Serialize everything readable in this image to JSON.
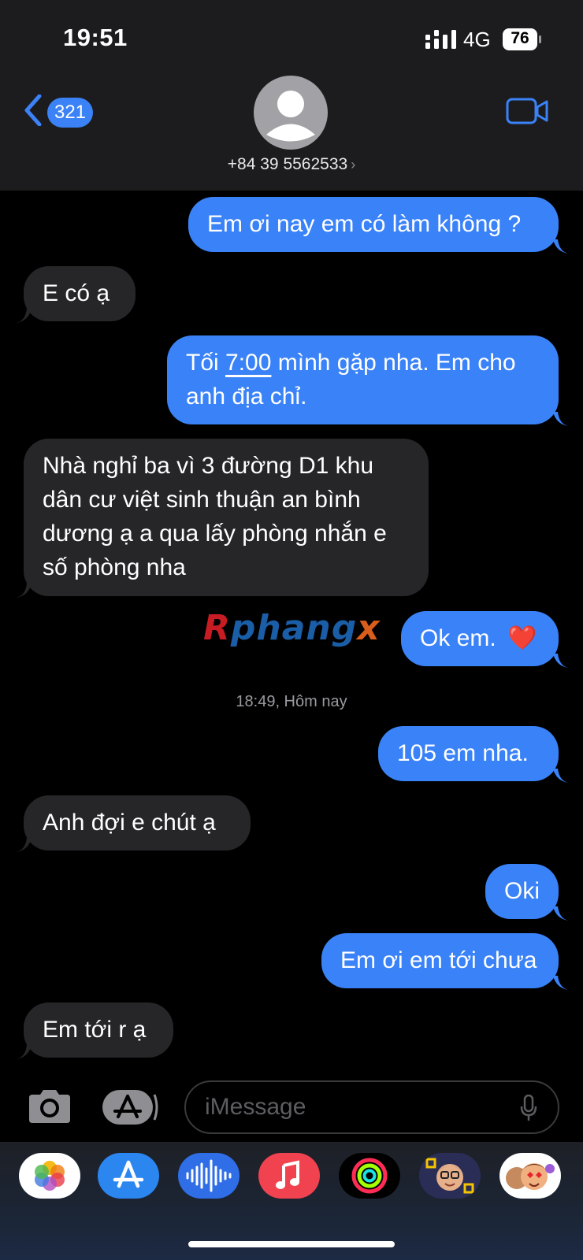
{
  "status_bar": {
    "time": "19:51",
    "network": "4G",
    "battery": "76"
  },
  "header": {
    "back_count": "321",
    "contact_number": "+84 39 5562533",
    "contact_chevron": "›",
    "icons": [
      "chevron-left-icon",
      "avatar-icon",
      "video-call-icon"
    ]
  },
  "messages": [
    {
      "direction": "outgoing",
      "lines": [
        "Em ơi nay em có làm không ?"
      ]
    },
    {
      "direction": "incoming",
      "lines": [
        "E có ạ"
      ]
    },
    {
      "direction": "outgoing",
      "line1_pre": "Tối ",
      "line1_link": "7:00",
      "line1_post": " mình gặp nha. Em cho",
      "line2": "anh địa chỉ."
    },
    {
      "direction": "incoming",
      "lines": [
        "Nhà nghỉ ba vì 3 đường D1 khu",
        "dân cư việt sinh thuận an bình",
        "dương ạ a qua lấy phòng nhắn e",
        "số phòng nha"
      ]
    },
    {
      "direction": "outgoing",
      "text": "Ok em.",
      "emoji": "❤️"
    },
    {
      "direction": "outgoing",
      "lines": [
        "105 em nha."
      ]
    },
    {
      "direction": "incoming",
      "lines": [
        "Anh đợi e chút ạ"
      ]
    },
    {
      "direction": "outgoing",
      "lines": [
        "Oki"
      ]
    },
    {
      "direction": "outgoing",
      "lines": [
        "Em ơi em tới chưa"
      ]
    },
    {
      "direction": "incoming",
      "lines": [
        "Em tới r ạ"
      ]
    }
  ],
  "timestamp": "18:49, Hôm nay",
  "watermark": {
    "part1": "R",
    "part2": "phang",
    "part3": "x"
  },
  "composer": {
    "placeholder": "iMessage",
    "icons": [
      "camera-icon",
      "app-store-icon",
      "microphone-icon"
    ]
  },
  "dock": {
    "apps": [
      "photos-icon",
      "app-store-icon",
      "audio-icon",
      "music-icon",
      "activity-icon",
      "memoji-icon",
      "animoji-icon"
    ]
  },
  "colors": {
    "outgoing": "#3a82f7",
    "incoming": "#262629",
    "accent": "#3b82f6"
  }
}
